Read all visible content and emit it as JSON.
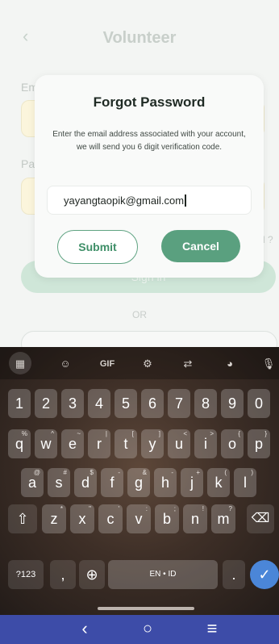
{
  "app": {
    "title": "Volunteer",
    "back_icon": "‹",
    "email_label_partial": "Em",
    "password_label_partial": "Pa",
    "signin_label": "Sign in",
    "or_label": "OR",
    "forgot_partial": "d ?"
  },
  "dialog": {
    "title": "Forgot Password",
    "description": "Enter the email address associated with your account, we will send you 6 digit verification code.",
    "email_value": "yayangtaopik@gmail.com",
    "submit_label": "Submit",
    "cancel_label": "Cancel"
  },
  "keyboard": {
    "toolbar": [
      {
        "name": "apps-grid-icon",
        "glyph": "▦"
      },
      {
        "name": "sticker-icon",
        "glyph": "☺"
      },
      {
        "name": "gif-button",
        "glyph": "GIF"
      },
      {
        "name": "settings-gear-icon",
        "glyph": "⚙"
      },
      {
        "name": "translate-icon",
        "glyph": "⇄"
      },
      {
        "name": "theme-palette-icon",
        "glyph": "◕"
      },
      {
        "name": "microphone-icon",
        "glyph": "🎙"
      }
    ],
    "row1": [
      {
        "k": "1"
      },
      {
        "k": "2"
      },
      {
        "k": "3"
      },
      {
        "k": "4"
      },
      {
        "k": "5"
      },
      {
        "k": "6"
      },
      {
        "k": "7"
      },
      {
        "k": "8"
      },
      {
        "k": "9"
      },
      {
        "k": "0"
      }
    ],
    "row2": [
      {
        "k": "q",
        "h": "%"
      },
      {
        "k": "w",
        "h": "^"
      },
      {
        "k": "e",
        "h": "~"
      },
      {
        "k": "r",
        "h": "|"
      },
      {
        "k": "t",
        "h": "["
      },
      {
        "k": "y",
        "h": "]"
      },
      {
        "k": "u",
        "h": "<"
      },
      {
        "k": "i",
        "h": ">"
      },
      {
        "k": "o",
        "h": "{"
      },
      {
        "k": "p",
        "h": "}"
      }
    ],
    "row3": [
      {
        "k": "a",
        "h": "@"
      },
      {
        "k": "s",
        "h": "#"
      },
      {
        "k": "d",
        "h": "$"
      },
      {
        "k": "f",
        "h": "-"
      },
      {
        "k": "g",
        "h": "&"
      },
      {
        "k": "h",
        "h": "-"
      },
      {
        "k": "j",
        "h": "+"
      },
      {
        "k": "k",
        "h": "("
      },
      {
        "k": "l",
        "h": ")"
      }
    ],
    "row4": [
      {
        "k": "z",
        "h": "*"
      },
      {
        "k": "x",
        "h": "\""
      },
      {
        "k": "c",
        "h": "'"
      },
      {
        "k": "v",
        "h": ":"
      },
      {
        "k": "b",
        "h": ";"
      },
      {
        "k": "n",
        "h": "!"
      },
      {
        "k": "m",
        "h": "?"
      }
    ],
    "shift_glyph": "⇧",
    "backspace_glyph": "⌫",
    "symbols_label": "?123",
    "comma_label": ",",
    "globe_glyph": "⊕",
    "space_label": "EN • ID",
    "period_label": ".",
    "enter_glyph": "✓"
  },
  "navbar": {
    "back_glyph": "‹",
    "home_glyph": "○",
    "menu_glyph": "≡"
  }
}
